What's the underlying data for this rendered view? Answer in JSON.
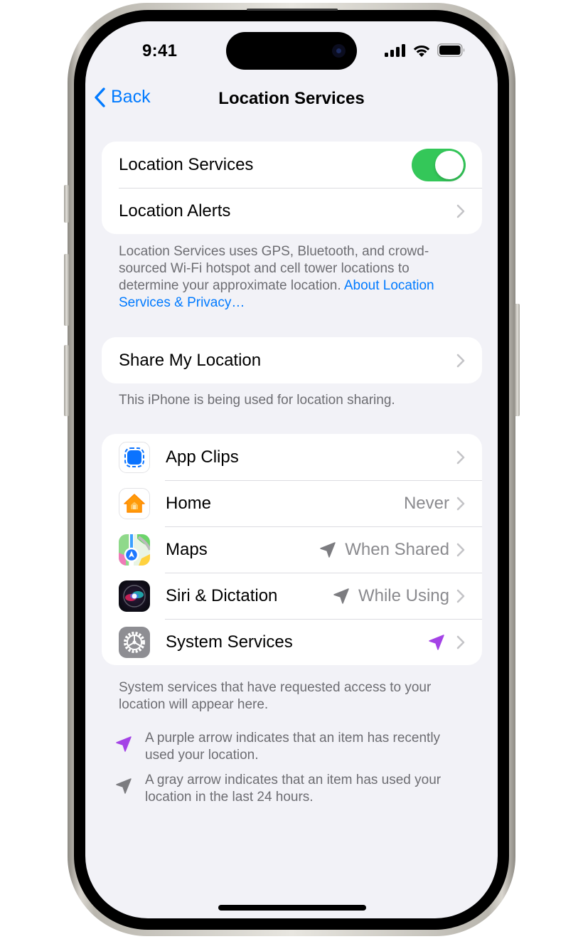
{
  "status_bar": {
    "time": "9:41",
    "icons": [
      "cellular-signal-icon",
      "wifi-icon",
      "battery-icon"
    ]
  },
  "nav": {
    "back_label": "Back",
    "title": "Location Services"
  },
  "section_main": {
    "location_services": {
      "label": "Location Services",
      "toggle_on": true
    },
    "location_alerts": {
      "label": "Location Alerts"
    },
    "footnote": "Location Services uses GPS, Bluetooth, and crowd-sourced Wi-Fi hotspot and cell tower locations to determine your approximate location. ",
    "footnote_link": "About Location Services & Privacy…"
  },
  "section_share": {
    "label": "Share My Location",
    "footnote": "This iPhone is being used for location sharing."
  },
  "apps": [
    {
      "name": "App Clips",
      "icon": "app-clips-icon",
      "value": "",
      "arrow": ""
    },
    {
      "name": "Home",
      "icon": "home-app-icon",
      "value": "Never",
      "arrow": ""
    },
    {
      "name": "Maps",
      "icon": "maps-app-icon",
      "value": "When Shared",
      "arrow": "gray"
    },
    {
      "name": "Siri & Dictation",
      "icon": "siri-icon",
      "value": "While Using",
      "arrow": "gray"
    },
    {
      "name": "System Services",
      "icon": "system-services-gear-icon",
      "value": "",
      "arrow": "purple"
    }
  ],
  "apps_footnote": "System services that have requested access to your location will appear here.",
  "legend": [
    {
      "color": "purple",
      "text": "A purple arrow indicates that an item has recently used your location."
    },
    {
      "color": "gray",
      "text": "A gray arrow indicates that an item has used your location in the last 24 hours."
    }
  ],
  "colors": {
    "accent": "#007aff",
    "toggle_on": "#34c759",
    "arrow_purple": "#a443e6",
    "arrow_gray": "#7c7c80",
    "background": "#f2f2f7"
  }
}
